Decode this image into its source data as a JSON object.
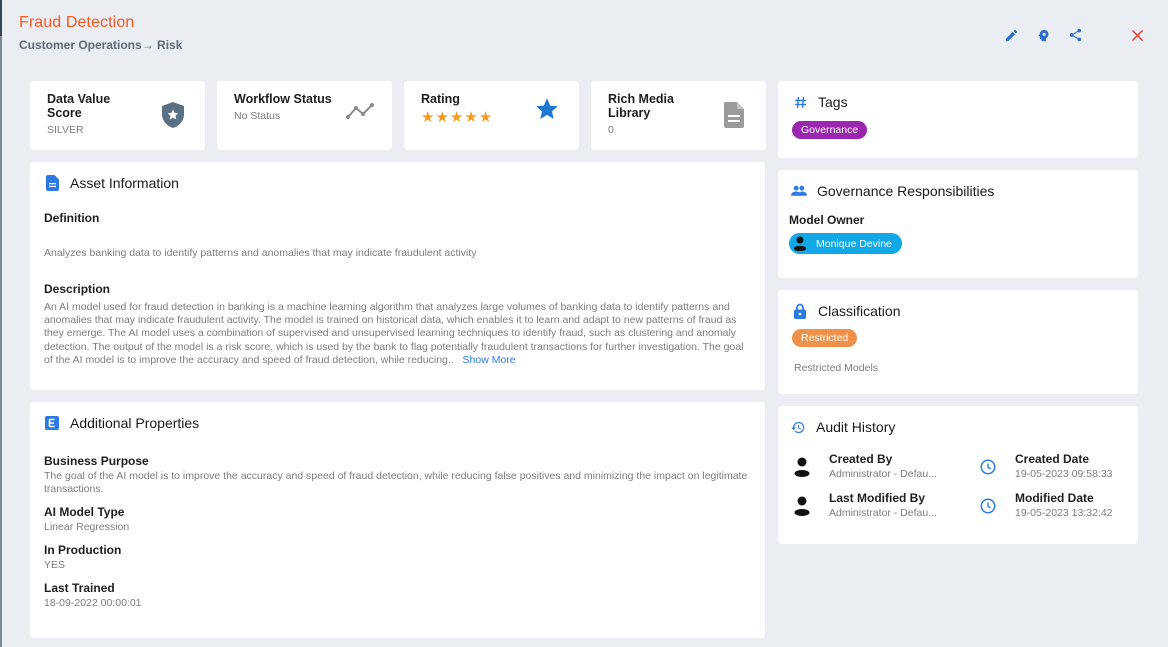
{
  "header": {
    "title": "Fraud Detection",
    "breadcrumb": "Customer Operations→ Risk",
    "actions": [
      {
        "name": "edit",
        "icon": "pencil-icon"
      },
      {
        "name": "ai-insights",
        "icon": "brain-head-icon"
      },
      {
        "name": "share",
        "icon": "share-icon"
      },
      {
        "name": "close",
        "icon": "close-icon"
      }
    ]
  },
  "colors": {
    "title": "#f05a28",
    "accent": "#2c7be5",
    "tag_governance": "#9b27b0",
    "owner_pill": "#11a8e8",
    "classification_pill": "#f0914b",
    "close": "#e53935",
    "rating_star": "#f39c1f"
  },
  "stats": {
    "data_value": {
      "title": "Data Value Score",
      "value": "SILVER",
      "icon": "shield-star-icon"
    },
    "workflow": {
      "title": "Workflow Status",
      "value": "No Status",
      "icon": "trend-line-icon"
    },
    "rating": {
      "title": "Rating",
      "stars": 5,
      "max": 5,
      "icon": "star-icon"
    },
    "rich_media": {
      "title": "Rich Media Library",
      "value": "0",
      "icon": "document-icon"
    }
  },
  "asset": {
    "title": "Asset Information",
    "definition_label": "Definition",
    "definition": "Analyzes banking data to identify patterns and anomalies that may indicate fraudulent activity",
    "description_label": "Description",
    "description": "An AI model used for fraud detection in banking is a machine learning algorithm that analyzes large volumes of banking data to identify patterns and anomalies that may indicate fraudulent activity. The model is trained on historical data, which enables it to learn and adapt to new patterns of fraud as they emerge. The AI model uses a combination of supervised and unsupervised learning techniques to identify fraud, such as clustering and anomaly detection. The output of the model is a risk score, which is used by the bank to flag potentially fraudulent transactions for further investigation. The goal of the AI model is to improve the accuracy and speed of fraud detection, while reducing..",
    "show_more": "Show More"
  },
  "properties": {
    "title": "Additional Properties",
    "items": [
      {
        "label": "Business Purpose",
        "value": "The goal of the AI model is to improve the accuracy and speed of fraud detection, while reducing false positives and minimizing the impact on legitimate transactions."
      },
      {
        "label": "AI Model Type",
        "value": "Linear Regression"
      },
      {
        "label": "In Production",
        "value": "YES"
      },
      {
        "label": "Last Trained",
        "value": "18-09-2022 00:00:01"
      }
    ]
  },
  "tags": {
    "title": "Tags",
    "items": [
      "Governance"
    ]
  },
  "governance": {
    "title": "Governance Responsibilities",
    "role": "Model Owner",
    "owner": "Monique Devine"
  },
  "classification": {
    "title": "Classification",
    "level": "Restricted",
    "note": "Restricted Models"
  },
  "audit": {
    "title": "Audit History",
    "created_by_label": "Created By",
    "created_by": "Administrator - Defau...",
    "created_date_label": "Created Date",
    "created_date": "19-05-2023 09:58:33",
    "modified_by_label": "Last Modified By",
    "modified_by": "Administrator - Defau...",
    "modified_date_label": "Modified Date",
    "modified_date": "19-05-2023 13:32:42"
  }
}
